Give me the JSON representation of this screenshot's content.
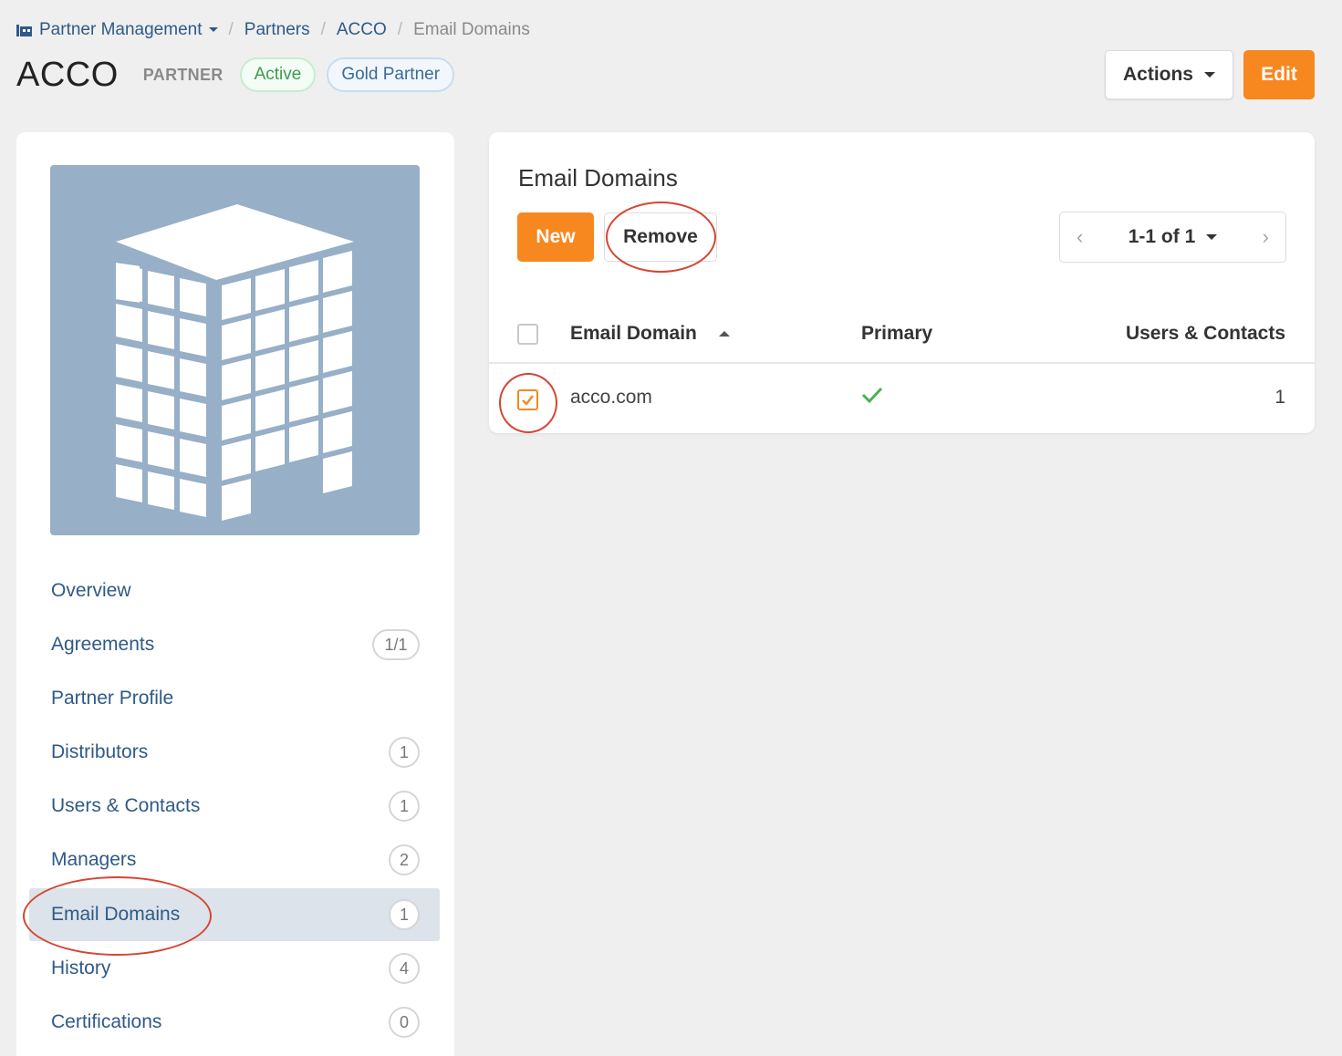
{
  "breadcrumb": {
    "items": [
      "Partner Management",
      "Partners",
      "ACCO",
      "Email Domains"
    ],
    "separator": "/"
  },
  "header": {
    "title": "ACCO",
    "type_label": "PARTNER",
    "status_badge": "Active",
    "tier_badge": "Gold Partner",
    "actions_label": "Actions",
    "edit_label": "Edit"
  },
  "sidebar": {
    "items": [
      {
        "label": "Overview",
        "count": null
      },
      {
        "label": "Agreements",
        "count": "1/1"
      },
      {
        "label": "Partner Profile",
        "count": null
      },
      {
        "label": "Distributors",
        "count": "1"
      },
      {
        "label": "Users & Contacts",
        "count": "1"
      },
      {
        "label": "Managers",
        "count": "2"
      },
      {
        "label": "Email Domains",
        "count": "1"
      },
      {
        "label": "History",
        "count": "4"
      },
      {
        "label": "Certifications",
        "count": "0"
      }
    ],
    "selected": "Email Domains"
  },
  "email_domains": {
    "title": "Email Domains",
    "new_label": "New",
    "remove_label": "Remove",
    "pagination": "1-1 of 1",
    "columns": [
      "Email Domain",
      "Primary",
      "Users & Contacts"
    ],
    "rows": [
      {
        "domain": "acco.com",
        "primary": true,
        "users_contacts": "1",
        "checked": true
      }
    ]
  },
  "colors": {
    "accent": "#f7871f",
    "link": "#2f5a87",
    "success": "#4caf50",
    "annotation": "#d64533"
  }
}
